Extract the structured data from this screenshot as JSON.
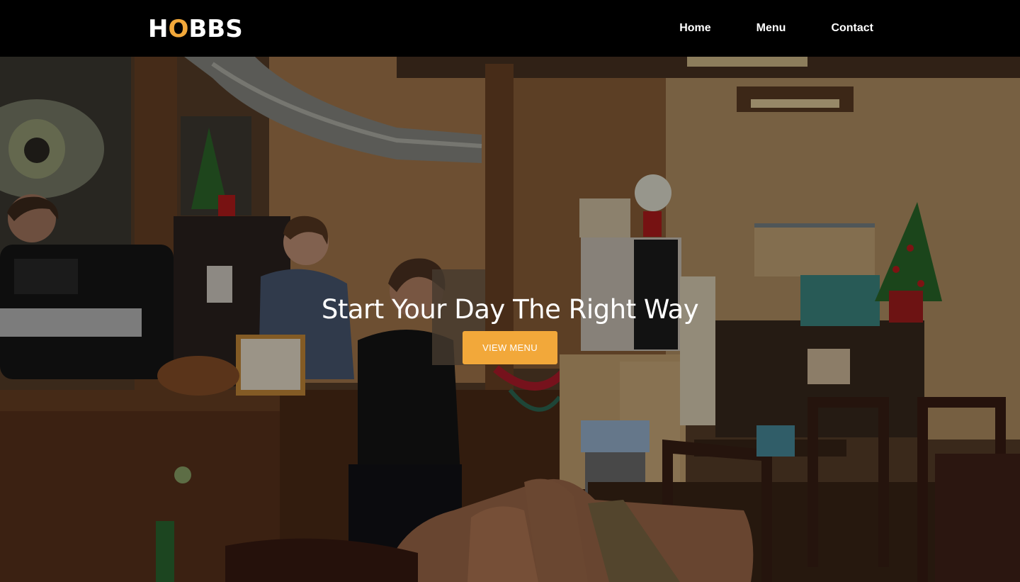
{
  "header": {
    "logo": {
      "text_before": "H",
      "text_accent": "O",
      "text_after": "BBS"
    },
    "nav": [
      {
        "label": "Home"
      },
      {
        "label": "Menu"
      },
      {
        "label": "Contact"
      }
    ]
  },
  "hero": {
    "title": "Start Your Day The Right Way",
    "button_label": "VIEW MENU",
    "image": "coffee-shop-interior-photo"
  },
  "colors": {
    "header_bg": "#000000",
    "accent": "#f2a83a",
    "text": "#ffffff"
  }
}
